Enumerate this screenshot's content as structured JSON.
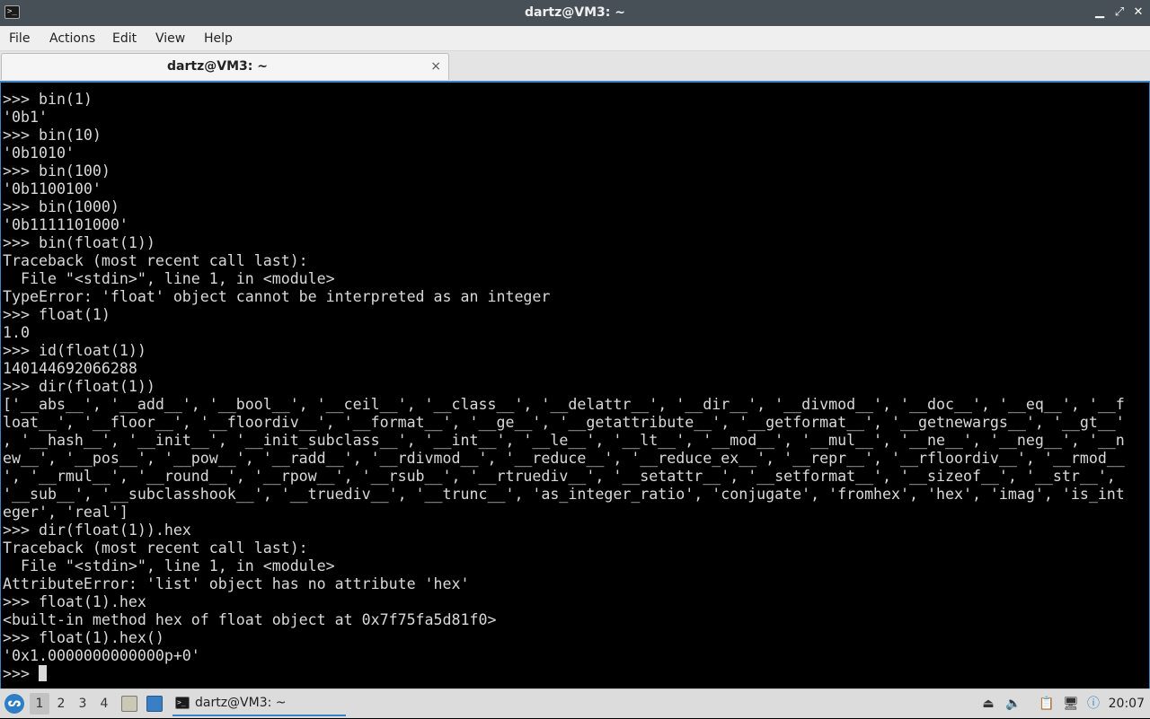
{
  "window": {
    "title": "dartz@VM3: ~",
    "icon": "terminal-icon",
    "controls": [
      "minimize-icon",
      "maximize-icon",
      "close-icon"
    ]
  },
  "menu": {
    "items": [
      "File",
      "Actions",
      "Edit",
      "View",
      "Help"
    ]
  },
  "tabs": [
    {
      "label": "dartz@VM3: ~",
      "close": "×"
    }
  ],
  "terminal": {
    "lines": [
      ">>> bin(1)",
      "'0b1'",
      ">>> bin(10)",
      "'0b1010'",
      ">>> bin(100)",
      "'0b1100100'",
      ">>> bin(1000)",
      "'0b1111101000'",
      ">>> bin(float(1))",
      "Traceback (most recent call last):",
      "  File \"<stdin>\", line 1, in <module>",
      "TypeError: 'float' object cannot be interpreted as an integer",
      ">>> float(1)",
      "1.0",
      ">>> id(float(1))",
      "140144692066288",
      ">>> dir(float(1))",
      "['__abs__', '__add__', '__bool__', '__ceil__', '__class__', '__delattr__', '__dir__', '__divmod__', '__doc__', '__eq__', '__f",
      "loat__', '__floor__', '__floordiv__', '__format__', '__ge__', '__getattribute__', '__getformat__', '__getnewargs__', '__gt__'",
      ", '__hash__', '__init__', '__init_subclass__', '__int__', '__le__', '__lt__', '__mod__', '__mul__', '__ne__', '__neg__', '__n",
      "ew__', '__pos__', '__pow__', '__radd__', '__rdivmod__', '__reduce__', '__reduce_ex__', '__repr__', '__rfloordiv__', '__rmod__",
      "', '__rmul__', '__round__', '__rpow__', '__rsub__', '__rtruediv__', '__setattr__', '__setformat__', '__sizeof__', '__str__',",
      "'__sub__', '__subclasshook__', '__truediv__', '__trunc__', 'as_integer_ratio', 'conjugate', 'fromhex', 'hex', 'imag', 'is_int",
      "eger', 'real']",
      ">>> dir(float(1)).hex",
      "Traceback (most recent call last):",
      "  File \"<stdin>\", line 1, in <module>",
      "AttributeError: 'list' object has no attribute 'hex'",
      ">>> float(1).hex",
      "<built-in method hex of float object at 0x7f75fa5d81f0>",
      ">>> float(1).hex()",
      "'0x1.0000000000000p+0'"
    ],
    "prompt": ">>> "
  },
  "taskbar": {
    "start_icon": "start-menu-icon",
    "workspaces": [
      "1",
      "2",
      "3",
      "4"
    ],
    "active_workspace": "1",
    "launchers": [
      "file-manager-icon",
      "desktop-icon"
    ],
    "task": {
      "label": "dartz@VM3: ~",
      "icon": "terminal-icon"
    },
    "tray_icons": [
      "eject-icon",
      "volume-icon",
      "clipboard-icon",
      "network-icon",
      "update-notifier-icon"
    ],
    "clock": "20:07"
  }
}
